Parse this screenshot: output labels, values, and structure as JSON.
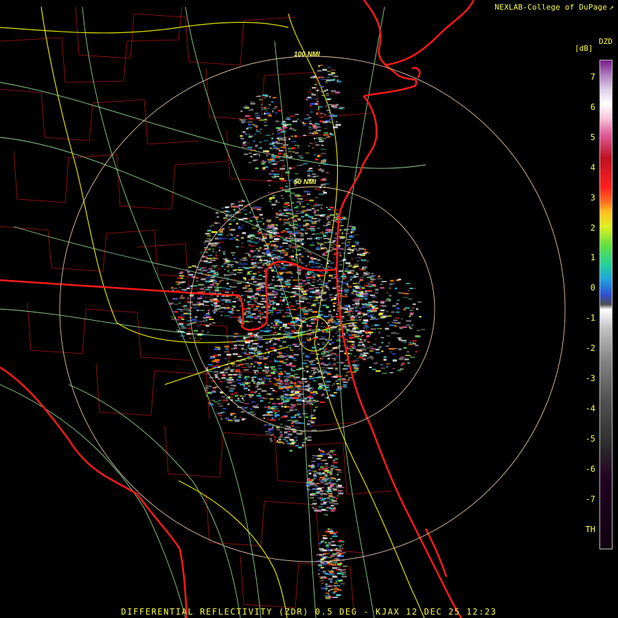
{
  "credit": {
    "text": "NEXLAB-College of DuPage",
    "mark": "↗"
  },
  "legend": {
    "title": "DZD",
    "unit": "[dB]",
    "ticks": [
      "7",
      "6",
      "5",
      "4",
      "3",
      "2",
      "1",
      "0",
      "-1",
      "-2",
      "-3",
      "-4",
      "-5",
      "-6",
      "-7",
      "TH"
    ]
  },
  "rings": {
    "inner": "50 NMI",
    "outer": "100 NMI"
  },
  "footer": "DIFFERENTIAL REFLECTIVITY (ZDR) 0.5 DEG - KJAX 12 DEC 25 12:23",
  "colors": {
    "background": "#000000",
    "state_border": "#ff2020",
    "county_line": "#c01818",
    "highway": "#ffff00",
    "road": "#a0e0a0",
    "range_ring": "#e8c8a8",
    "label": "#ffff44"
  }
}
